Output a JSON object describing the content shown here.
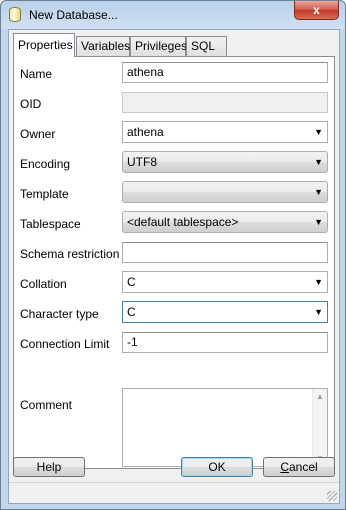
{
  "window": {
    "title": "New Database...",
    "close_glyph": "x"
  },
  "tabs": [
    {
      "label": "Properties",
      "active": true
    },
    {
      "label": "Variables",
      "active": false
    },
    {
      "label": "Privileges",
      "active": false
    },
    {
      "label": "SQL",
      "active": false
    }
  ],
  "form": {
    "name": {
      "label": "Name",
      "value": "athena"
    },
    "oid": {
      "label": "OID",
      "value": ""
    },
    "owner": {
      "label": "Owner",
      "value": "athena"
    },
    "encoding": {
      "label": "Encoding",
      "value": "UTF8"
    },
    "template": {
      "label": "Template",
      "value": ""
    },
    "tablespace": {
      "label": "Tablespace",
      "value": "<default tablespace>"
    },
    "schema_restriction": {
      "label": "Schema restriction",
      "value": ""
    },
    "collation": {
      "label": "Collation",
      "value": "C"
    },
    "character_type": {
      "label": "Character type",
      "value": "C"
    },
    "connection_limit": {
      "label": "Connection Limit",
      "value": "-1"
    },
    "comment": {
      "label": "Comment",
      "value": ""
    }
  },
  "buttons": {
    "help": "Help",
    "ok": "OK",
    "cancel_first": "C",
    "cancel_rest": "ancel"
  },
  "icons": {
    "app": "database-icon",
    "dropdown": "chevron-down-icon",
    "close": "close-icon"
  },
  "colors": {
    "titlebar": "#b9d1ea",
    "close_button": "#c0392b",
    "focus_border": "#3c7fb1"
  }
}
